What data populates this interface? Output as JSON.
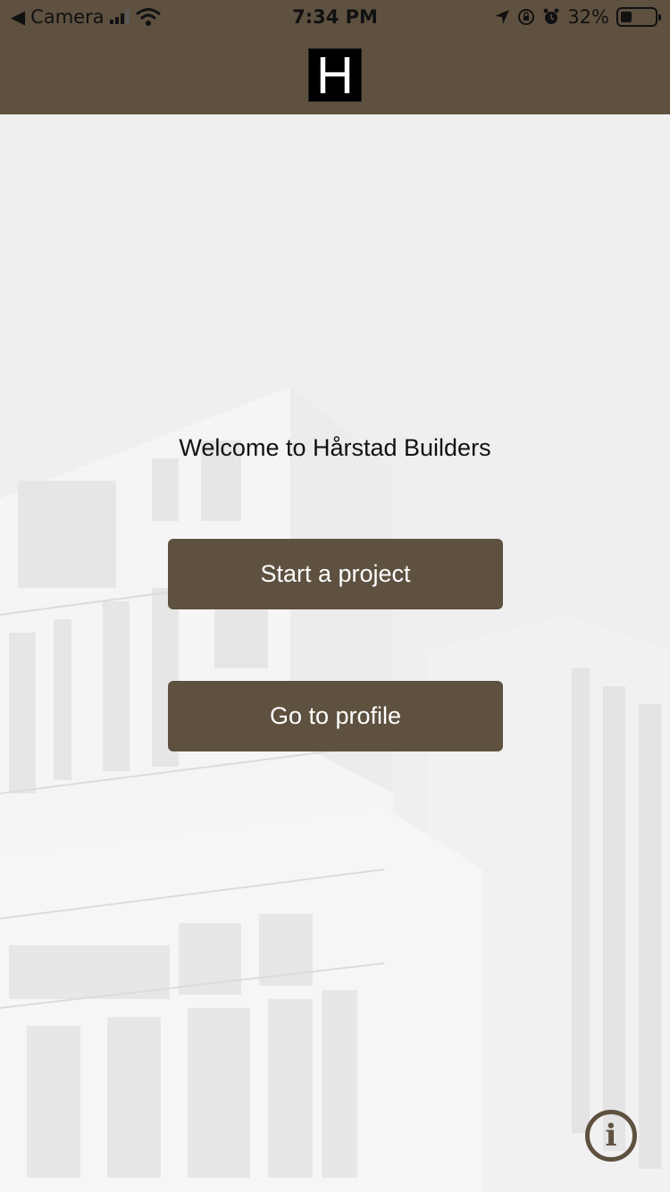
{
  "status_bar": {
    "back_label": "Camera",
    "time": "7:34 PM",
    "battery_percent": "32%",
    "battery_level": 0.32,
    "icons": [
      "back-arrow-icon",
      "signal-icon",
      "wifi-icon",
      "location-icon",
      "rotation-lock-icon",
      "alarm-icon",
      "battery-icon"
    ]
  },
  "header": {
    "logo_letter": "H",
    "background_color": "#5e5140"
  },
  "main": {
    "welcome_text": "Welcome to Hårstad Builders",
    "buttons": {
      "start_project": "Start a project",
      "go_to_profile": "Go to profile"
    },
    "info_icon_glyph": "i"
  },
  "colors": {
    "brand": "#5e5140",
    "background": "#efefef",
    "text": "#111111",
    "button_text": "#ffffff"
  }
}
